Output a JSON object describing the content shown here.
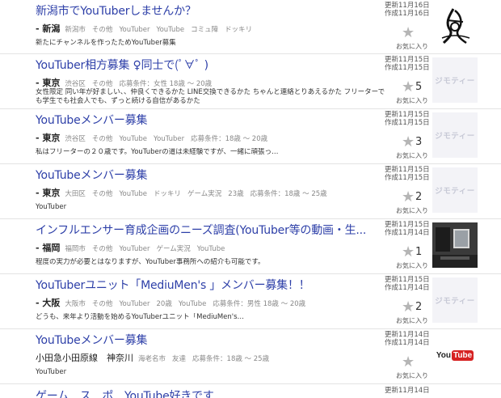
{
  "labels": {
    "favorite": "お気に入り",
    "thumb_placeholder": "ジモティー",
    "youtube_you": "You",
    "youtube_tube": "Tube"
  },
  "items": [
    {
      "title": "新潟市でYouTuberしませんか？",
      "prefecture": "- 新潟",
      "tags": [
        "新潟市",
        "その他",
        "YouTuber",
        "YouTube",
        "コミュ障",
        "ドッキリ"
      ],
      "description": "新たにチャンネルを作ったためYouTuber募集",
      "updated": "更新11月16日",
      "created": "作成11月16日",
      "fav_count": "",
      "thumb": "calligraphy"
    },
    {
      "title": "YouTuber相方募集 ♀同士で(ﾟ∀ﾟ )",
      "prefecture": "- 東京",
      "tags": [
        "渋谷区",
        "その他",
        "応募条件：女性 18歳 〜 20歳"
      ],
      "description": "女性限定 同い年が好ましい、、仲良くできるかた LINE交換できるかた ちゃんと連絡とりあえるかた フリーターでも学生でも社会人でも、ずっと続ける自信があるかた",
      "updated": "更新11月15日",
      "created": "作成11月15日",
      "fav_count": "5",
      "thumb": "placeholder"
    },
    {
      "title": "YouTubeメンバー募集",
      "prefecture": "- 東京",
      "tags": [
        "渋谷区",
        "その他",
        "YouTube",
        "YouTuber",
        "応募条件：18歳 〜 20歳"
      ],
      "description": "私はフリーターの２０歳です。YouTuberの道は未経験ですが、一緒に頑張っ…",
      "updated": "更新11月15日",
      "created": "作成11月15日",
      "fav_count": "3",
      "thumb": "placeholder"
    },
    {
      "title": "YouTubeメンバー募集",
      "prefecture": "- 東京",
      "tags": [
        "大田区",
        "その他",
        "YouTube",
        "ドッキリ",
        "ゲーム実況",
        "23歳",
        "応募条件：18歳 〜 25歳"
      ],
      "description": "YouTuber",
      "updated": "更新11月15日",
      "created": "作成11月15日",
      "fav_count": "2",
      "thumb": "placeholder"
    },
    {
      "title": "インフルエンサー育成企画のニーズ調査(YouTuber等の動画・生...",
      "prefecture": "- 福岡",
      "tags": [
        "福岡市",
        "その他",
        "YouTuber",
        "ゲーム実況",
        "YouTube"
      ],
      "description": "程度の実力が必要とはなりますが、YouTuber事務所への紹介も可能です。",
      "updated": "更新11月15日",
      "created": "作成11月14日",
      "fav_count": "1",
      "thumb": "photo"
    },
    {
      "title": "YouTuberユニット「MediuMen's 」メンバー募集！！",
      "prefecture": "- 大阪",
      "tags": [
        "大阪市",
        "その他",
        "YouTuber",
        "20歳",
        "YouTube",
        "応募条件：男性 18歳 〜 20歳"
      ],
      "description": "どうも、来年より活動を始めるYouTuberユニット「MediuMen's…",
      "updated": "更新11月15日",
      "created": "作成11月14日",
      "fav_count": "2",
      "thumb": "placeholder"
    },
    {
      "title": "YouTubeメンバー募集",
      "prefecture": "小田急小田原線　神奈川",
      "tags": [
        "海老名市",
        "友達",
        "応募条件：18歳 〜 25歳"
      ],
      "description": "YouTuber",
      "updated": "更新11月14日",
      "created": "作成11月14日",
      "fav_count": "",
      "thumb": "youtube"
    }
  ],
  "partial_item": {
    "title": "ゲーム…ス…ポ…YouTube好きです",
    "updated": "更新11月14日"
  }
}
